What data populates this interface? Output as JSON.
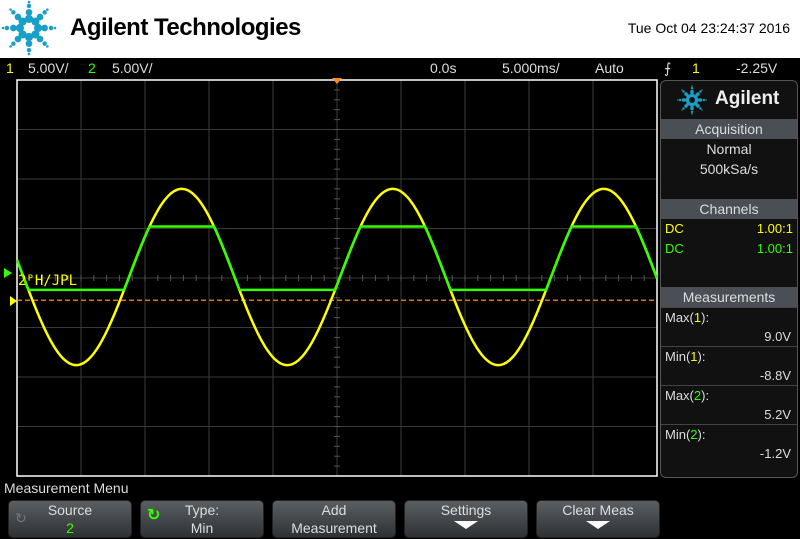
{
  "header": {
    "brand": "Agilent Technologies",
    "datetime": "Tue Oct 04 23:24:37 2016"
  },
  "status": {
    "ch1_num": "1",
    "ch1_scale": "5.00V/",
    "ch2_num": "2",
    "ch2_scale": "5.00V/",
    "time_delay": "0.0s",
    "time_scale": "5.000ms/",
    "trigger_mode": "Auto",
    "trigger_edge_icon": "rising-edge",
    "trigger_source": "1",
    "trigger_level": "-2.25V"
  },
  "screen": {
    "ch2_label": "2ᴾH/JPL"
  },
  "panel": {
    "logo": "Agilent",
    "acq_title": "Acquisition",
    "acq_mode": "Normal",
    "acq_rate": "500kSa/s",
    "channels_title": "Channels",
    "channels": [
      {
        "coupling": "DC",
        "probe": "1.00:1",
        "color": "#ffff00"
      },
      {
        "coupling": "DC",
        "probe": "1.00:1",
        "color": "#33ff00"
      }
    ],
    "meas_title": "Measurements",
    "measurements": [
      {
        "label": "Max(",
        "ch": "1",
        "value": "9.0V"
      },
      {
        "label": "Min(",
        "ch": "1",
        "value": "-8.8V"
      },
      {
        "label": "Max(",
        "ch": "2",
        "value": "5.2V"
      },
      {
        "label": "Min(",
        "ch": "2",
        "value": "-1.2V"
      }
    ]
  },
  "menu": {
    "title": "Measurement Menu",
    "buttons": [
      {
        "top": "Source",
        "bottom": "2"
      },
      {
        "top": "Type:",
        "bottom": "Min"
      },
      {
        "top": "Add",
        "bottom": "Measurement"
      },
      {
        "top": "Settings"
      },
      {
        "top": "Clear Meas"
      }
    ]
  },
  "chart_data": {
    "type": "line",
    "series": [
      {
        "name": "1",
        "color": "#ffff00",
        "max": 9.0,
        "min": -8.8
      },
      {
        "name": "2",
        "color": "#33ff00",
        "max": 5.2,
        "min": -1.2
      }
    ],
    "trigger_level": -2.25,
    "volts_per_div": 5.0,
    "time_per_div_ms": 5.0,
    "grid": true
  }
}
